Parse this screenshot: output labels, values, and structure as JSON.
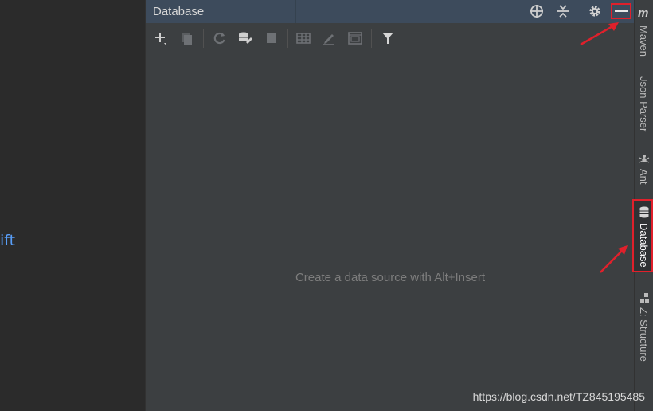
{
  "editor": {
    "visible_text": "ift"
  },
  "panel": {
    "title": "Database",
    "empty_message": "Create a data source with Alt+Insert",
    "header_icons": [
      "target-icon",
      "collapse-icon",
      "gear-icon",
      "minimize-icon"
    ],
    "toolbar_icons": [
      "add-icon",
      "copy-icon",
      "refresh-icon",
      "data-source-properties-icon",
      "stop-icon",
      "table-icon",
      "edit-icon",
      "console-icon",
      "filter-icon"
    ]
  },
  "stripe": {
    "items": [
      {
        "label": "Maven",
        "icon": "maven-icon",
        "icon_text": "m"
      },
      {
        "label": "Json Parser",
        "icon": ""
      },
      {
        "label": "Ant",
        "icon": "ant-icon"
      },
      {
        "label": "Database",
        "icon": "database-icon",
        "active": true
      },
      {
        "label": "Z: Structure",
        "icon": "structure-icon"
      }
    ]
  },
  "watermark": "https://blog.csdn.net/TZ845195485",
  "colors": {
    "highlight": "#e0202b",
    "link": "#589df6",
    "panel_bg": "#3c3f41",
    "header_bg": "#3d4b5c"
  }
}
